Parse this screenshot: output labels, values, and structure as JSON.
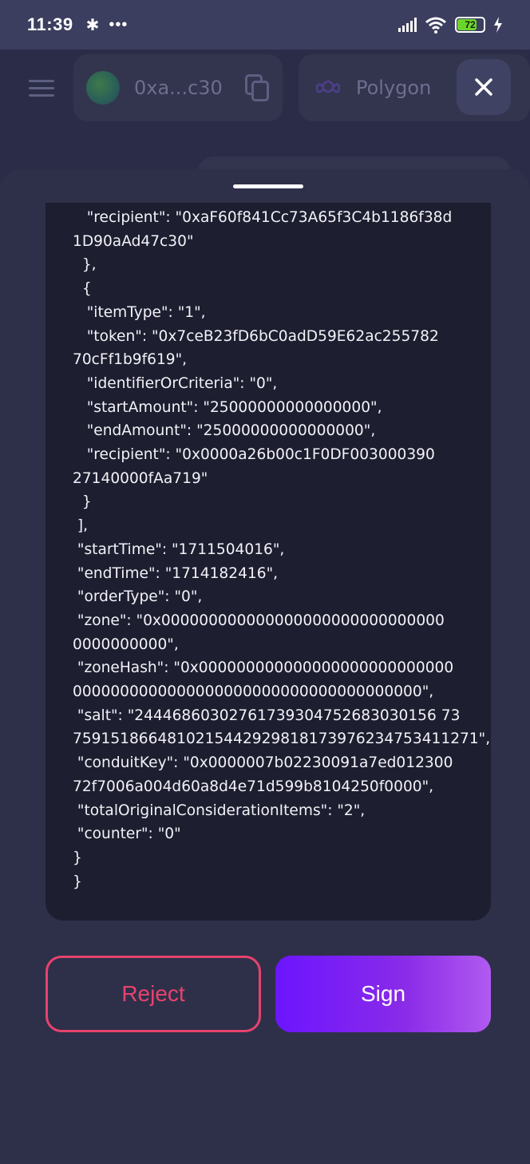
{
  "status_bar": {
    "time": "11:39",
    "dots": "•••",
    "battery": "72"
  },
  "header": {
    "wallet_address": "0xa...c30",
    "network": "Polygon"
  },
  "code_lines": [
    "   \"recipient\": \"0xaF60f841Cc73A65f3C4b1186f38d",
    "1D90aAd47c30\"",
    "  },",
    "  {",
    "   \"itemType\": \"1\",",
    "   \"token\": \"0x7ceB23fD6bC0adD59E62ac255782",
    "70cFf1b9f619\",",
    "   \"identifierOrCriteria\": \"0\",",
    "   \"startAmount\": \"25000000000000000\",",
    "   \"endAmount\": \"25000000000000000\",",
    "   \"recipient\": \"0x0000a26b00c1F0DF003000390",
    "27140000fAa719\"",
    "  }",
    " ],",
    " \"startTime\": \"1711504016\",",
    " \"endTime\": \"1714182416\",",
    " \"orderType\": \"0\",",
    " \"zone\": \"0x000000000000000000000000000000",
    "0000000000\",",
    " \"zoneHash\": \"0x000000000000000000000000000",
    "0000000000000000000000000000000000000\",",
    " \"salt\": \"24446860302761739304752683030156 73",
    "7591518664810215442929818173976234753411271\",",
    " \"conduitKey\": \"0x0000007b02230091a7ed012300",
    "72f7006a004d60a8d4e71d599b8104250f0000\",",
    " \"totalOriginalConsiderationItems\": \"2\",",
    " \"counter\": \"0\"",
    "}",
    "}"
  ],
  "actions": {
    "reject": "Reject",
    "sign": "Sign"
  },
  "colors": {
    "reject": "#e8426e",
    "sign_start": "#6c15ff",
    "sign_end": "#b15af0",
    "background": "#2b2d48"
  }
}
